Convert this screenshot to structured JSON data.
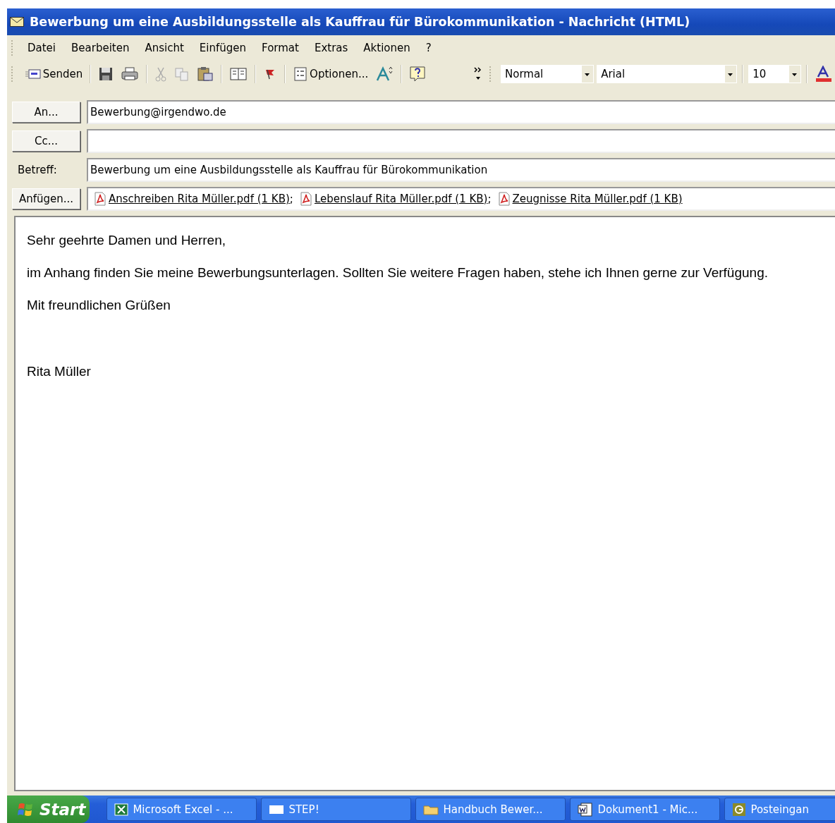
{
  "window": {
    "title": "Bewerbung um eine Ausbildungsstelle als Kauffrau für Bürokommunikation - Nachricht (HTML)"
  },
  "menu": [
    "Datei",
    "Bearbeiten",
    "Ansicht",
    "Einfügen",
    "Format",
    "Extras",
    "Aktionen",
    "?"
  ],
  "toolbar": {
    "send": "Senden",
    "options": "Optionen...",
    "style": "Normal",
    "font": "Arial",
    "size": "10"
  },
  "header": {
    "to_button": "An...",
    "to": "Bewerbung@irgendwo.de",
    "cc_button": "Cc...",
    "subject_label": "Betreff:",
    "subject": "Bewerbung um eine Ausbildungsstelle als Kauffrau für Bürokommunikation",
    "attach_button": "Anfügen...",
    "attachments": [
      {
        "name": "Anschreiben Rita Müller.pdf (1 KB)",
        "separator": ";"
      },
      {
        "name": "Lebenslauf Rita Müller.pdf (1 KB)",
        "separator": ";"
      },
      {
        "name": "Zeugnisse Rita Müller.pdf (1 KB)"
      }
    ]
  },
  "body": {
    "paragraphs": [
      "Sehr geehrte Damen und Herren,",
      "im Anhang finden Sie meine Bewerbungsunterlagen. Sollten Sie weitere Fragen haben, stehe ich Ihnen gerne zur Verfügung.",
      "Mit freundlichen Grüßen",
      "Rita Müller"
    ]
  },
  "taskbar": {
    "start": "Start",
    "tasks": [
      {
        "label": "Microsoft Excel - ...",
        "kind": "excel"
      },
      {
        "label": "STEP!",
        "kind": "window"
      },
      {
        "label": "Handbuch Bewer...",
        "kind": "folder"
      },
      {
        "label": "Dokument1 - Mic...",
        "kind": "word"
      },
      {
        "label": "Posteingan",
        "kind": "outlook"
      }
    ]
  }
}
